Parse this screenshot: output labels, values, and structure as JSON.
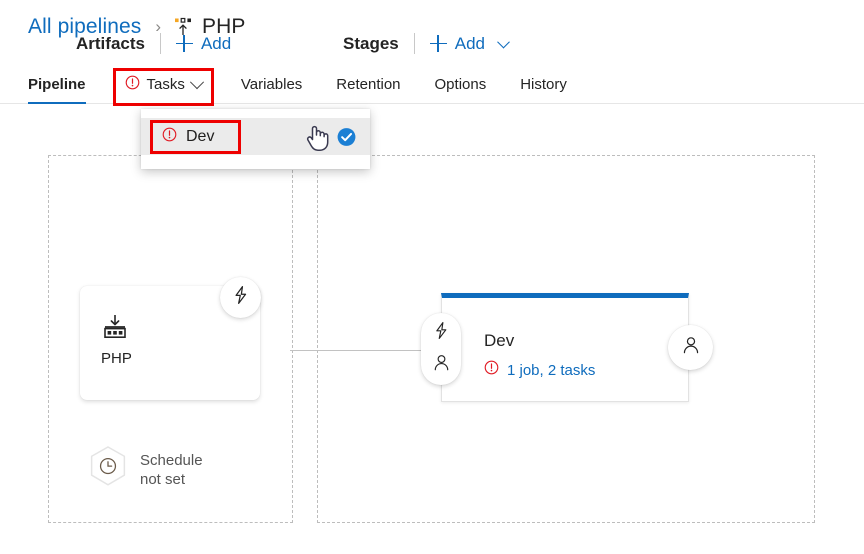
{
  "breadcrumb": {
    "root_label": "All pipelines",
    "separator": "›",
    "current_label": "PHP",
    "current_icon": "release-pipeline-icon"
  },
  "tabs": [
    {
      "label": "Pipeline",
      "active": true,
      "error": false,
      "chevron": false,
      "highlighted": false
    },
    {
      "label": "Tasks",
      "active": false,
      "error": true,
      "chevron": true,
      "highlighted": true
    },
    {
      "label": "Variables",
      "active": false,
      "error": false,
      "chevron": false,
      "highlighted": false
    },
    {
      "label": "Retention",
      "active": false,
      "error": false,
      "chevron": false,
      "highlighted": false
    },
    {
      "label": "Options",
      "active": false,
      "error": false,
      "chevron": false,
      "highlighted": false
    },
    {
      "label": "History",
      "active": false,
      "error": false,
      "chevron": false,
      "highlighted": false
    }
  ],
  "tasks_dropdown": {
    "open": true,
    "items": [
      {
        "label": "Dev",
        "error": true,
        "selected": true,
        "hovered": true,
        "highlighted": true
      }
    ],
    "check_icon": "check-circle-icon",
    "cursor_icon": "pointing-hand-cursor"
  },
  "artifacts_panel": {
    "title": "Artifacts",
    "add_label": "Add",
    "add_icon": "plus-icon",
    "card": {
      "name": "PHP",
      "icon": "artifact-build-icon",
      "trigger_badge_icon": "lightning-bolt-icon"
    },
    "schedule": {
      "text": "Schedule\nnot set",
      "icon": "clock-hexagon-icon"
    }
  },
  "stages_panel": {
    "title": "Stages",
    "add_label": "Add",
    "add_icon": "plus-icon",
    "add_chevron_icon": "chevron-down-icon",
    "stage": {
      "name": "Dev",
      "status_text": "1 job, 2 tasks",
      "status_error": true,
      "pre_deployment_icons": [
        "lightning-bolt-icon",
        "person-icon"
      ],
      "post_deployment_icon": "person-icon"
    }
  },
  "colors": {
    "accent_blue": "#0f6cbd",
    "error_red": "#e01b24",
    "highlight_box_red": "#ee0000",
    "stage_top_bar": "#0f6cbd",
    "hover_gray": "#ebebeb",
    "panel_dash": "#bdbdbd"
  }
}
